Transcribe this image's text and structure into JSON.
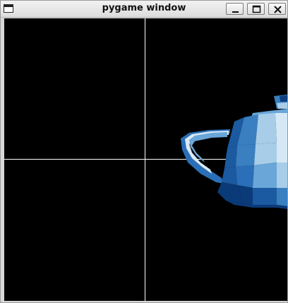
{
  "window": {
    "title": "pygame window",
    "icons": {
      "app": "window-app-icon",
      "minimize": "minimize-icon",
      "maximize": "maximize-icon",
      "close": "close-icon"
    }
  },
  "scene": {
    "background_color": "#000000",
    "crosshair_color": "#ffffff",
    "object": "teapot",
    "palette": [
      "#0b3a78",
      "#1b5aa0",
      "#3a7fc0",
      "#6aa6d8",
      "#a8cde9",
      "#d6e8f5",
      "#eef6fc"
    ]
  }
}
